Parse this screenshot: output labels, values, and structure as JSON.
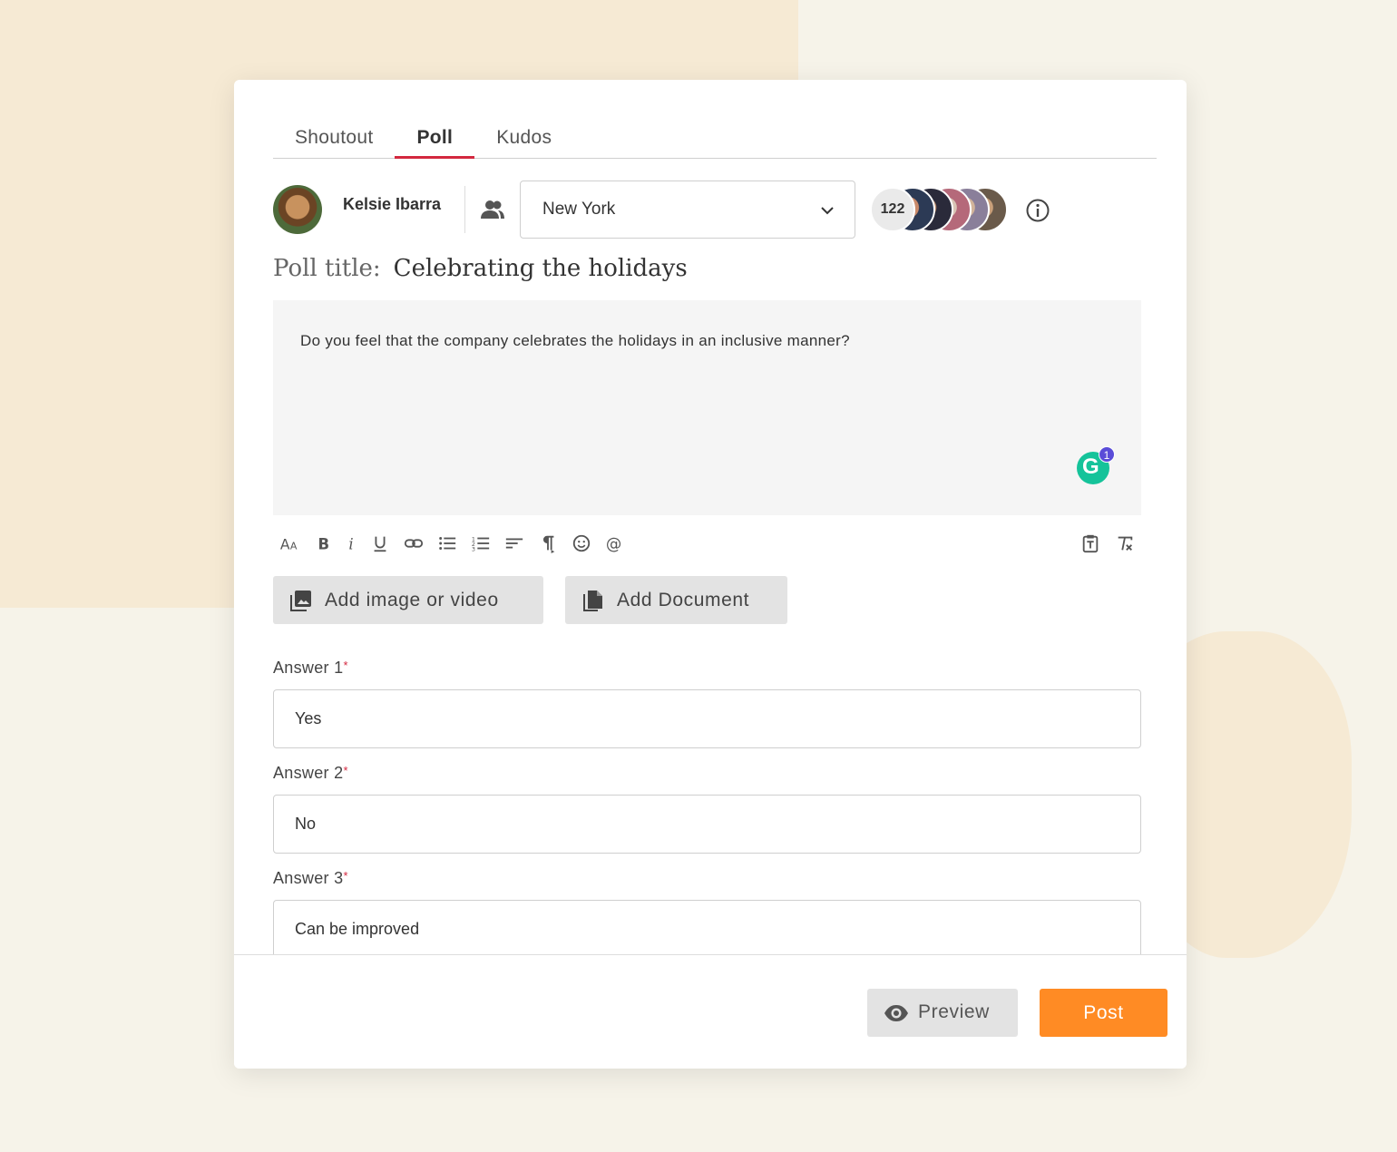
{
  "tabs": [
    {
      "label": "Shoutout",
      "active": false
    },
    {
      "label": "Poll",
      "active": true
    },
    {
      "label": "Kudos",
      "active": false
    }
  ],
  "author": {
    "name": "Kelsie Ibarra",
    "avatar_icon": "user-avatar"
  },
  "audience": {
    "selected": "New York",
    "icon": "group-icon"
  },
  "members": {
    "count": "122"
  },
  "poll": {
    "title_label": "Poll title:",
    "title": "Celebrating the holidays",
    "question": "Do you feel that the company celebrates the holidays in an inclusive manner?"
  },
  "grammarly": {
    "letter": "G",
    "badge": "1"
  },
  "toolbar": {
    "icons": [
      "font-size-icon",
      "bold-icon",
      "italic-icon",
      "underline-icon",
      "link-icon",
      "bullet-list-icon",
      "numbered-list-icon",
      "align-icon",
      "paragraph-icon",
      "emoji-icon",
      "mention-icon",
      "paste-text-icon",
      "clear-format-icon"
    ]
  },
  "media": {
    "image_video_label": "Add image or video",
    "document_label": "Add Document"
  },
  "answers": [
    {
      "label": "Answer 1",
      "value": "Yes"
    },
    {
      "label": "Answer 2",
      "value": "No"
    },
    {
      "label": "Answer 3",
      "value": "Can be improved"
    }
  ],
  "required_marker": "*",
  "footer": {
    "preview_label": "Preview",
    "post_label": "Post"
  },
  "colors": {
    "accent": "#d3283f",
    "post": "#ff8b24",
    "grammarly": "#15c39a",
    "badge": "#5a4cd8"
  }
}
